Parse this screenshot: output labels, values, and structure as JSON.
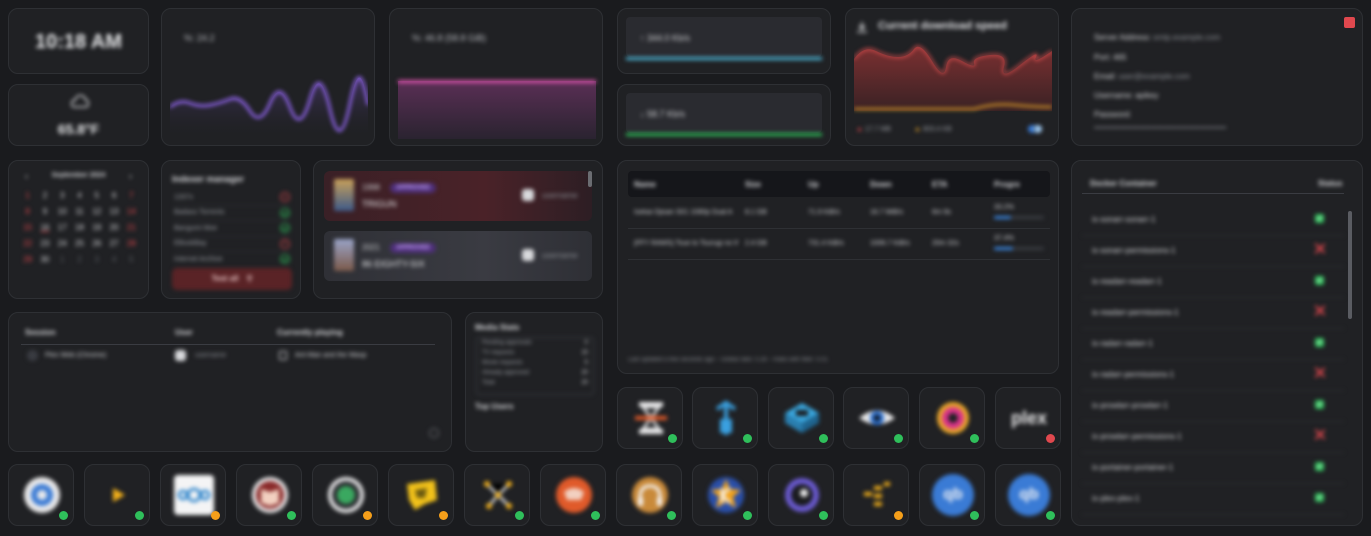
{
  "clock": {
    "time": "10:18 AM"
  },
  "weather": {
    "temp": "65.8°F",
    "icon": "cloud-icon"
  },
  "cpu": {
    "label": "%: 24.2",
    "color": "#9b6bff"
  },
  "memory": {
    "label": "%: 46.8 (58.8 GiB)",
    "color": "#e054b0"
  },
  "network": {
    "upload": "↑ 344.0 Kb/s",
    "download": "↓ 58.7 Kb/s",
    "up_color": "#4fb6d8",
    "down_color": "#2fbf5b"
  },
  "download_speed": {
    "title": "Current download speed",
    "downloaded": "17.7 MB",
    "uploaded": "803.4 KB"
  },
  "smtp": {
    "server_label": "Server Address:",
    "server_value": "smtp.example.com",
    "port": "Port: 465",
    "email_label": "Email:",
    "email_value": "user@example.com",
    "username": "Username: apikey",
    "password_label": "Password:",
    "password_value": "••••••••••••••••••••••••••••••••••••••••••••••••••••••"
  },
  "calendar": {
    "month": "September 2024",
    "cells": [
      "1",
      "2",
      "3",
      "4",
      "5",
      "6",
      "7",
      "8",
      "9",
      "10",
      "11",
      "12",
      "13",
      "14",
      "15",
      "16",
      "17",
      "18",
      "19",
      "20",
      "21",
      "22",
      "23",
      "24",
      "25",
      "26",
      "27",
      "28",
      "29",
      "30",
      "1",
      "2",
      "3",
      "4",
      "5"
    ]
  },
  "indexer": {
    "title": "Indexer manager",
    "items": [
      {
        "name": "1337x",
        "status": "error"
      },
      {
        "name": "Badass Torrents",
        "status": "ok"
      },
      {
        "name": "Bangumi Moe",
        "status": "ok"
      },
      {
        "name": "EBookBay",
        "status": "error"
      },
      {
        "name": "Internet Archive",
        "status": "ok"
      }
    ],
    "test_all": "Test all"
  },
  "requests": [
    {
      "year": "1998",
      "badge": "APPROVED",
      "title": "TRIGUN",
      "user": "username"
    },
    {
      "year": "2021",
      "badge": "APPROVED",
      "title": "86 EIGHTY-SIX",
      "user": "username"
    }
  ],
  "torrents": {
    "headers": [
      "Name",
      "Size",
      "Up",
      "Down",
      "ETA",
      "Progre"
    ],
    "rows": [
      {
        "name": "Isekai Ojisan S01 1080p Dual A",
        "size": "8.1 GB",
        "up": "71.9 KiB/s",
        "down": "16.7 MiB/s",
        "eta": "6m 9s",
        "progress": "33.2%",
        "progress_value": 0.332
      },
      {
        "name": "[FFY RAWS] Tsue to Tsurugi no W",
        "size": "2.4 GB",
        "up": "731.4 KiB/s",
        "down": "1006.7 KiB/s",
        "eta": "20m 32s",
        "progress": "37.4%",
        "progress_value": 0.374
      }
    ],
    "footer": "Last updated a few seconds ago – Global ratio: 0.28 – Ratio with filter: 0.01"
  },
  "docker": {
    "header_name": "Docker Container",
    "header_status": "Status",
    "containers": [
      {
        "name": "ix-sonarr-sonarr-1",
        "status": "running"
      },
      {
        "name": "ix-sonarr-permissions-1",
        "status": "stopped"
      },
      {
        "name": "ix-readarr-readarr-1",
        "status": "running"
      },
      {
        "name": "ix-readarr-permissions-1",
        "status": "stopped"
      },
      {
        "name": "ix-radarr-radarr-1",
        "status": "running"
      },
      {
        "name": "ix-radarr-permissions-1",
        "status": "stopped"
      },
      {
        "name": "ix-prowlarr-prowlarr-1",
        "status": "running"
      },
      {
        "name": "ix-prowlarr-permissions-1",
        "status": "stopped"
      },
      {
        "name": "ix-portainer-portainer-1",
        "status": "running"
      },
      {
        "name": "ix-plex-plex-1",
        "status": "running"
      }
    ]
  },
  "sessions": {
    "headers": [
      "Session",
      "User",
      "Currently playing"
    ],
    "rows": [
      {
        "session": "Plex Web (Chrome)",
        "user": "username",
        "playing": "Ant-Man and the Wasp"
      }
    ]
  },
  "media_stats": {
    "title": "Media Stats",
    "rows": [
      {
        "label": "Pending approvals",
        "value": "0"
      },
      {
        "label": "TV requests",
        "value": "15"
      },
      {
        "label": "Movie requests",
        "value": "5"
      },
      {
        "label": "Already approved",
        "value": "20"
      },
      {
        "label": "Total",
        "value": "20"
      }
    ],
    "top_users": "Top Users"
  },
  "apps_right": [
    {
      "icon": "sabnzbd-icon",
      "status": "online"
    },
    {
      "icon": "transmission-icon",
      "status": "online"
    },
    {
      "icon": "portainer-box-icon",
      "status": "online"
    },
    {
      "icon": "eye-icon",
      "status": "online"
    },
    {
      "icon": "lidarr-icon",
      "status": "online"
    },
    {
      "icon": "plex-icon",
      "label": "plex",
      "status": "offline"
    }
  ],
  "apps_bottom": [
    {
      "icon": "overseerr-icon",
      "status": "online"
    },
    {
      "icon": "play-icon",
      "status": "online"
    },
    {
      "icon": "nextcloud-icon",
      "status": "warning"
    },
    {
      "icon": "readarr-book-icon",
      "status": "online"
    },
    {
      "icon": "sonarr-icon",
      "status": "warning"
    },
    {
      "icon": "jackett-icon",
      "status": "warning"
    },
    {
      "icon": "node-graph-icon",
      "status": "online"
    },
    {
      "icon": "mylar-icon",
      "status": "online"
    },
    {
      "icon": "audiobookshelf-icon",
      "status": "online"
    },
    {
      "icon": "komga-icon",
      "status": "online"
    },
    {
      "icon": "prowlarr-ring-icon",
      "status": "online"
    },
    {
      "icon": "tdarr-bars-icon",
      "status": "warning"
    },
    {
      "icon": "qbittorrent-icon",
      "label": "qb",
      "status": "online"
    },
    {
      "icon": "qbittorrent-icon",
      "label": "qb",
      "status": "online"
    }
  ]
}
